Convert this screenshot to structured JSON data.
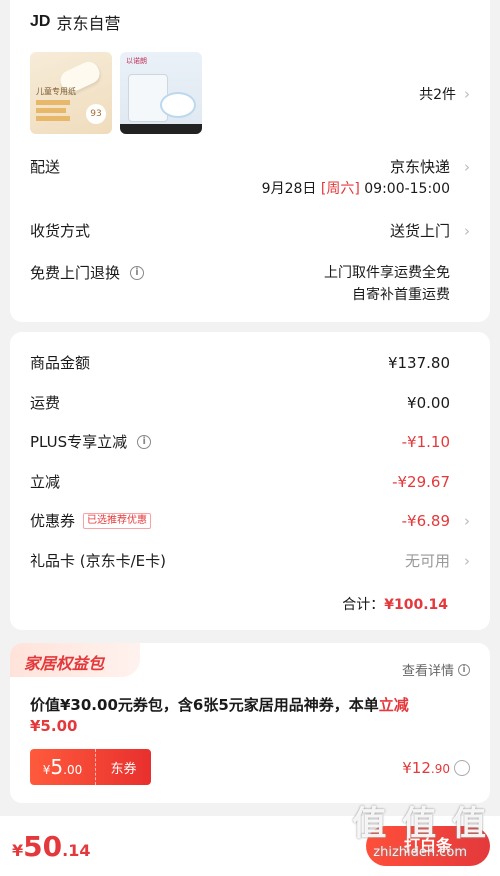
{
  "store": {
    "logo": "JD",
    "name": "京东自营"
  },
  "items": {
    "count_label": "共2件",
    "thumb1_text": "儿童专用纸",
    "thumb1_badge": "93",
    "thumb2_brand": "以诺朗"
  },
  "delivery": {
    "label": "配送",
    "method": "京东快递",
    "date": "9月28日",
    "weekday": "[周六]",
    "time": "09:00-15:00"
  },
  "receive": {
    "label": "收货方式",
    "value": "送货上门"
  },
  "return": {
    "label": "免费上门退换",
    "line1": "上门取件享运费全免",
    "line2": "自寄补首重运费"
  },
  "price": {
    "goods_label": "商品金额",
    "goods_value": "¥137.80",
    "shipping_label": "运费",
    "shipping_value": "¥0.00",
    "plus_label": "PLUS专享立减",
    "plus_value": "-¥1.10",
    "discount_label": "立减",
    "discount_value": "-¥29.67",
    "coupon_label": "优惠券",
    "coupon_tag": "已选推荐优惠",
    "coupon_value": "-¥6.89",
    "giftcard_label": "礼品卡 (京东卡/E卡)",
    "giftcard_value": "无可用",
    "total_label": "合计：",
    "total_value": "¥100.14"
  },
  "benefit": {
    "title": "家居权益包",
    "detail": "查看详情",
    "desc_prefix": "价值¥30.00元券包，含6张5元家居用品神券，本单",
    "desc_highlight": "立减",
    "desc_amount": "¥5.00",
    "coupon_currency": "¥",
    "coupon_amount": "5",
    "coupon_decimal": ".00",
    "coupon_type": "东券",
    "price_int": "¥12",
    "price_dec": ".90"
  },
  "footer": {
    "currency": "¥",
    "amount": "50",
    "decimal": ".14",
    "pay_label": "打白条",
    "watermark": "值 值 值",
    "watermark_url": "zhizhideh.com"
  }
}
